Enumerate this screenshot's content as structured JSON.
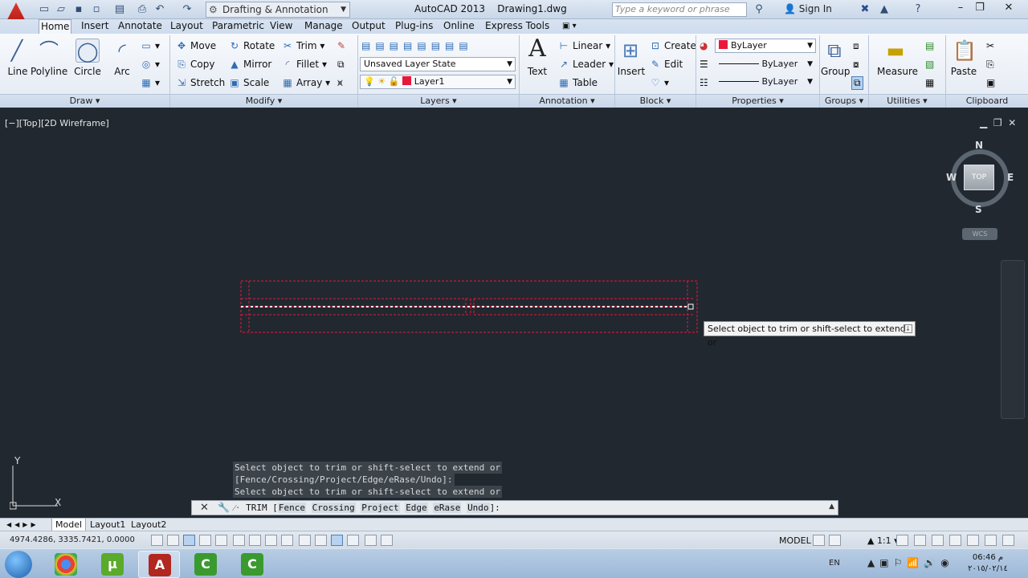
{
  "titlebar": {
    "workspace": "Drafting & Annotation",
    "app_title": "AutoCAD 2013    Drawing1.dwg",
    "search_placeholder": "Type a keyword or phrase",
    "signin": "Sign In"
  },
  "tabs": [
    "Home",
    "Insert",
    "Annotate",
    "Layout",
    "Parametric",
    "View",
    "Manage",
    "Output",
    "Plug-ins",
    "Online",
    "Express Tools"
  ],
  "ribbon": {
    "draw": {
      "title": "Draw",
      "line": "Line",
      "polyline": "Polyline",
      "circle": "Circle",
      "arc": "Arc"
    },
    "modify": {
      "title": "Modify",
      "move": "Move",
      "rotate": "Rotate",
      "trim": "Trim",
      "copy": "Copy",
      "mirror": "Mirror",
      "fillet": "Fillet",
      "stretch": "Stretch",
      "scale": "Scale",
      "array": "Array"
    },
    "layers": {
      "title": "Layers",
      "layer_state": "Unsaved Layer State",
      "current_layer": "Layer1"
    },
    "annotation": {
      "title": "Annotation",
      "text": "Text",
      "linear": "Linear",
      "leader": "Leader",
      "table": "Table"
    },
    "block": {
      "title": "Block",
      "insert": "Insert",
      "create": "Create",
      "edit": "Edit"
    },
    "properties": {
      "title": "Properties",
      "color": "ByLayer",
      "linetype": "ByLayer",
      "lineweight": "ByLayer"
    },
    "groups": {
      "title": "Groups",
      "group": "Group"
    },
    "utilities": {
      "title": "Utilities",
      "measure": "Measure"
    },
    "clipboard": {
      "title": "Clipboard",
      "paste": "Paste"
    }
  },
  "viewport": {
    "label": "[−][Top][2D Wireframe]",
    "viewcube": {
      "top": "TOP",
      "n": "N",
      "s": "S",
      "e": "E",
      "w": "W",
      "wcs": "WCS"
    },
    "tooltip": "Select object to trim or shift-select to extend or",
    "ucs_x": "X",
    "ucs_y": "Y"
  },
  "command": {
    "history": [
      "Select object to trim or shift-select to extend or",
      "[Fence/Crossing/Project/Edge/eRase/Undo]:",
      "Select object to trim or shift-select to extend or"
    ],
    "prompt_cmd": "TRIM [",
    "options": [
      "Fence",
      "Crossing",
      "Project",
      "Edge",
      "eRase",
      "Undo"
    ],
    "prompt_end": "]:"
  },
  "layout_tabs": [
    "Model",
    "Layout1",
    "Layout2"
  ],
  "status": {
    "coords": "4974.4286, 3335.7421, 0.0000",
    "model": "MODEL",
    "scale": "1:1"
  },
  "taskbar": {
    "lang": "EN",
    "time": "06:46 م",
    "date": "٢٠١٥/٠٢/١٤"
  },
  "colors": {
    "drawing_bg": "#212830",
    "entity": "#e8173b",
    "accent": "#2e6bb5"
  }
}
